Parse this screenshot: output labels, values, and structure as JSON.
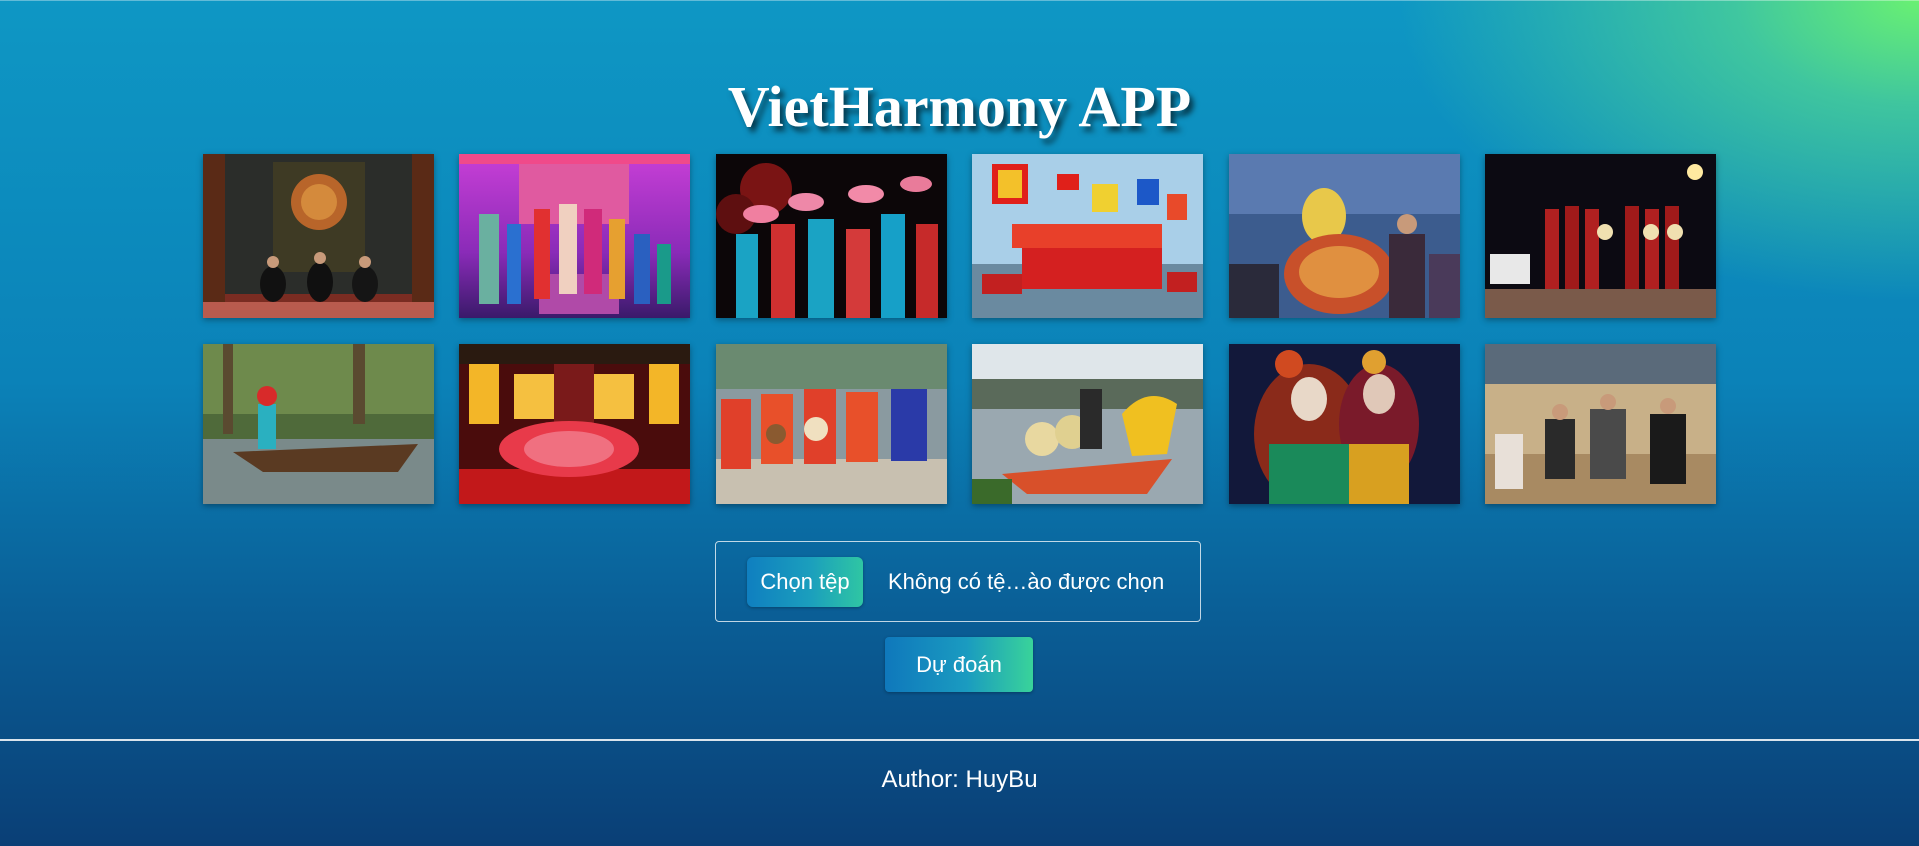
{
  "app": {
    "title": "VietHarmony APP"
  },
  "gallery": {
    "images": [
      {
        "name": "ca-tru-performance-photo"
      },
      {
        "name": "cheo-stage-photo"
      },
      {
        "name": "fan-dance-photo"
      },
      {
        "name": "boat-festival-flags-photo"
      },
      {
        "name": "ritual-ceremony-photo"
      },
      {
        "name": "night-singers-photo"
      },
      {
        "name": "don-ca-tai-tu-boat-photo"
      },
      {
        "name": "royal-court-dance-photo"
      },
      {
        "name": "musicians-red-costume-photo"
      },
      {
        "name": "quan-ho-dragon-boat-photo"
      },
      {
        "name": "tuong-opera-photo"
      },
      {
        "name": "folk-music-gathering-photo"
      }
    ]
  },
  "upload": {
    "choose_label": "Chọn tệp",
    "status_text": "Không có tệ…ào được chọn"
  },
  "actions": {
    "predict_label": "Dự đoán"
  },
  "footer": {
    "author_text": "Author: HuyBu"
  },
  "colors": {
    "background_top": "#0e97c4",
    "background_bottom": "#0a3f76",
    "accent_green": "#6ef56e",
    "button_blue": "#0f78bc",
    "button_green": "#39d39a"
  }
}
